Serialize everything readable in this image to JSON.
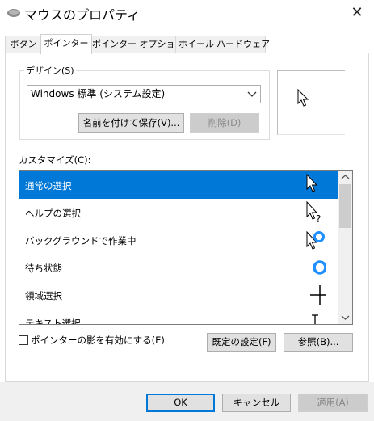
{
  "window": {
    "title": "マウスのプロパティ",
    "close_glyph": "✕"
  },
  "tabs": [
    {
      "label": "ボタン"
    },
    {
      "label": "ポインター"
    },
    {
      "label": "ポインター オプション"
    },
    {
      "label": "ホイール"
    },
    {
      "label": "ハードウェア"
    }
  ],
  "design": {
    "group_label": "デザイン(S)",
    "selected_scheme": "Windows 標準 (システム設定)",
    "save_as_label": "名前を付けて保存(V)...",
    "delete_label": "削除(D)"
  },
  "customize": {
    "label": "カスタマイズ(C):",
    "items": [
      {
        "label": "通常の選択",
        "cursor_icon": "arrow-cursor-icon",
        "selected": true
      },
      {
        "label": "ヘルプの選択",
        "cursor_icon": "help-cursor-icon",
        "selected": false
      },
      {
        "label": "バックグラウンドで作業中",
        "cursor_icon": "working-in-background-cursor-icon",
        "selected": false
      },
      {
        "label": "待ち状態",
        "cursor_icon": "busy-cursor-icon",
        "selected": false
      },
      {
        "label": "領域選択",
        "cursor_icon": "precision-select-cursor-icon",
        "selected": false
      },
      {
        "label": "テキスト選択",
        "cursor_icon": "text-select-cursor-icon",
        "selected": false
      }
    ]
  },
  "shadow_checkbox": {
    "label": "ポインターの影を有効にする(E)",
    "checked": false
  },
  "buttons": {
    "default_label": "既定の設定(F)",
    "browse_label": "参照(B)...",
    "ok_label": "OK",
    "cancel_label": "キャンセル",
    "apply_label": "適用(A)"
  },
  "colors": {
    "accent": "#0078d7",
    "busy_ring": "#1e90ff"
  }
}
